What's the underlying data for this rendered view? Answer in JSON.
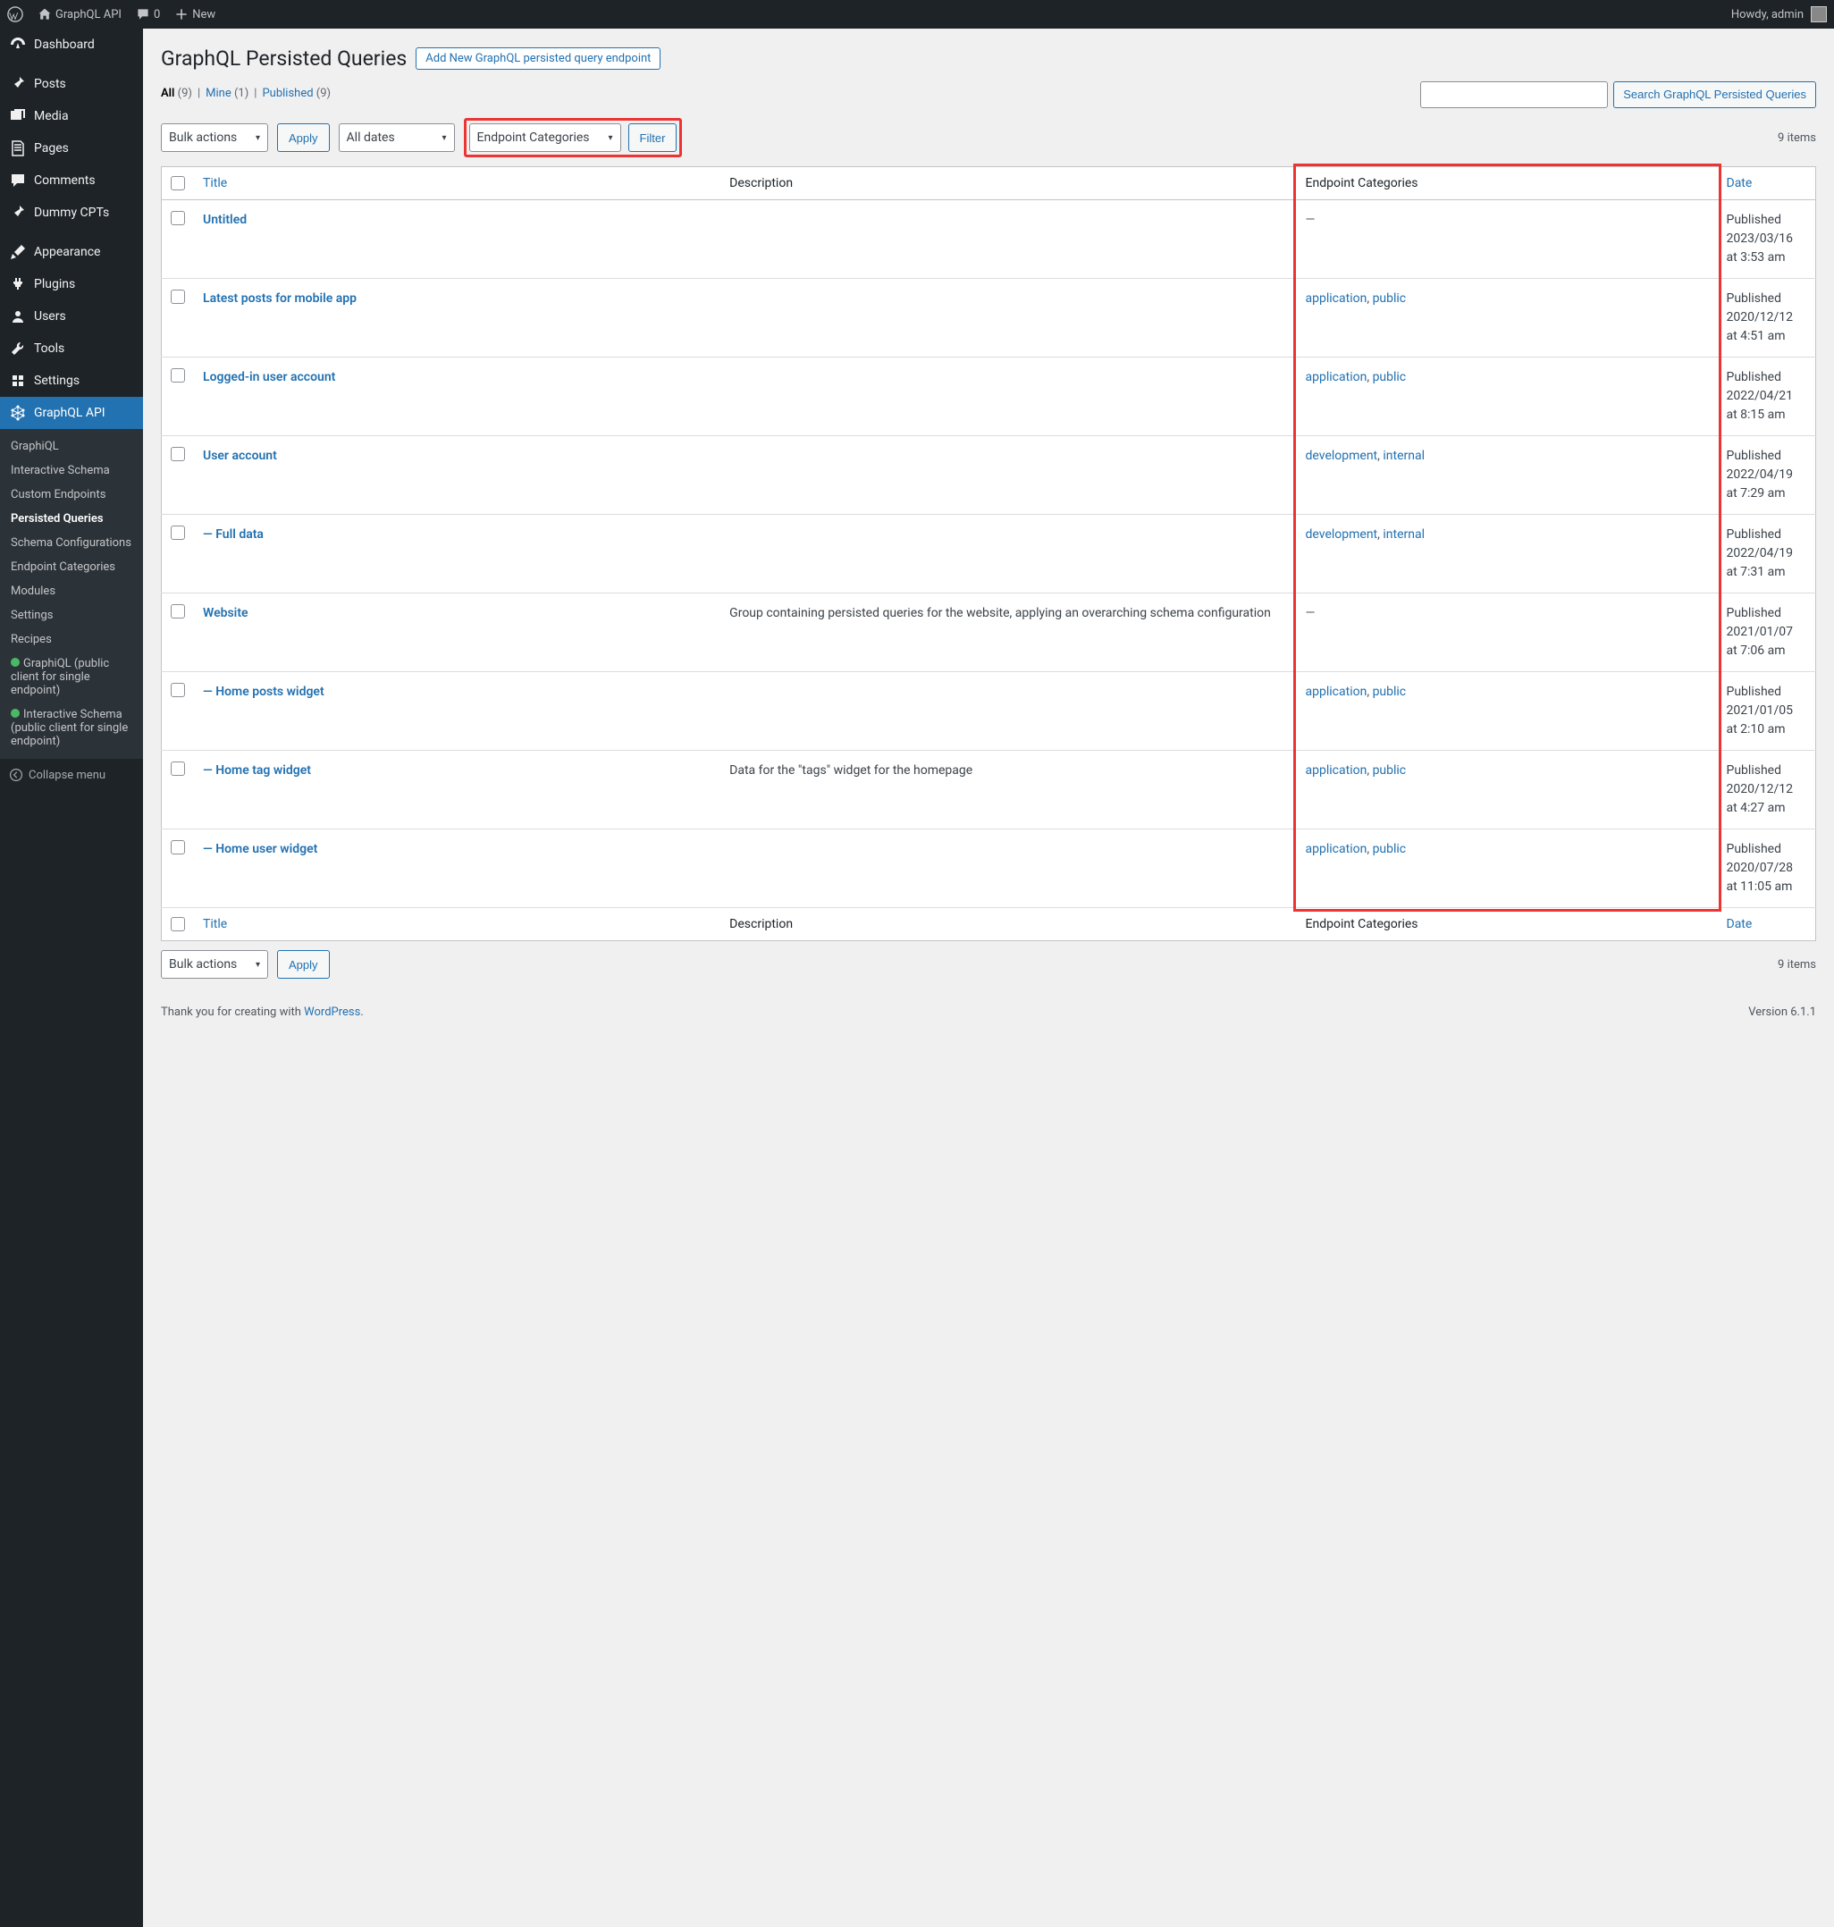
{
  "admin_bar": {
    "site_name": "GraphQL API",
    "comments": "0",
    "new": "New",
    "howdy": "Howdy, admin"
  },
  "sidebar": {
    "items": [
      {
        "label": "Dashboard",
        "icon": "dashboard"
      },
      {
        "label": "Posts",
        "icon": "pin"
      },
      {
        "label": "Media",
        "icon": "media"
      },
      {
        "label": "Pages",
        "icon": "pages"
      },
      {
        "label": "Comments",
        "icon": "comments"
      },
      {
        "label": "Dummy CPTs",
        "icon": "pin"
      },
      {
        "label": "Appearance",
        "icon": "brush"
      },
      {
        "label": "Plugins",
        "icon": "plugin"
      },
      {
        "label": "Users",
        "icon": "users"
      },
      {
        "label": "Tools",
        "icon": "tools"
      },
      {
        "label": "Settings",
        "icon": "settings"
      },
      {
        "label": "GraphQL API",
        "icon": "graphql"
      }
    ],
    "submenu": [
      {
        "label": "GraphiQL"
      },
      {
        "label": "Interactive Schema"
      },
      {
        "label": "Custom Endpoints"
      },
      {
        "label": "Persisted Queries",
        "current": true
      },
      {
        "label": "Schema Configurations"
      },
      {
        "label": "Endpoint Categories"
      },
      {
        "label": "Modules"
      },
      {
        "label": "Settings"
      },
      {
        "label": "Recipes"
      },
      {
        "label": "GraphiQL (public client for single endpoint)",
        "dot": true
      },
      {
        "label": "Interactive Schema (public client for single endpoint)",
        "dot": true
      }
    ],
    "collapse": "Collapse menu"
  },
  "page": {
    "title": "GraphQL Persisted Queries",
    "add_new": "Add New GraphQL persisted query endpoint"
  },
  "views": {
    "all_label": "All",
    "all_count": "(9)",
    "mine_label": "Mine",
    "mine_count": "(1)",
    "published_label": "Published",
    "published_count": "(9)"
  },
  "search": {
    "placeholder": "",
    "button": "Search GraphQL Persisted Queries"
  },
  "filters": {
    "bulk_actions": "Bulk actions",
    "apply": "Apply",
    "all_dates": "All dates",
    "endpoint_categories": "Endpoint Categories",
    "filter": "Filter",
    "items_count": "9 items"
  },
  "columns": {
    "title": "Title",
    "description": "Description",
    "categories": "Endpoint Categories",
    "date": "Date"
  },
  "rows": [
    {
      "title": "Untitled",
      "desc": "",
      "cats": [],
      "dash": "—",
      "date": "Published\n2023/03/16 at 3:53 am"
    },
    {
      "title": "Latest posts for mobile app",
      "desc": "",
      "cats": [
        "application",
        "public"
      ],
      "date": "Published\n2020/12/12 at 4:51 am"
    },
    {
      "title": "Logged-in user account",
      "desc": "",
      "cats": [
        "application",
        "public"
      ],
      "date": "Published\n2022/04/21 at 8:15 am"
    },
    {
      "title": "User account",
      "desc": "",
      "cats": [
        "development",
        "internal"
      ],
      "date": "Published\n2022/04/19 at 7:29 am"
    },
    {
      "title": "— Full data",
      "desc": "",
      "cats": [
        "development",
        "internal"
      ],
      "date": "Published\n2022/04/19 at 7:31 am",
      "indent": true
    },
    {
      "title": "Website",
      "desc": "Group containing persisted queries for the website, applying an overarching schema configuration",
      "cats": [],
      "dash": "—",
      "date": "Published\n2021/01/07 at 7:06 am"
    },
    {
      "title": "— Home posts widget",
      "desc": "",
      "cats": [
        "application",
        "public"
      ],
      "date": "Published\n2021/01/05 at 2:10 am",
      "indent": true
    },
    {
      "title": "— Home tag widget",
      "desc": "Data for the \"tags\" widget for the homepage",
      "cats": [
        "application",
        "public"
      ],
      "date": "Published\n2020/12/12 at 4:27 am",
      "indent": true
    },
    {
      "title": "— Home user widget",
      "desc": "",
      "cats": [
        "application",
        "public"
      ],
      "date": "Published\n2020/07/28 at 11:05 am",
      "indent": true
    }
  ],
  "footer": {
    "thanks": "Thank you for creating with ",
    "wp": "WordPress",
    "period": ".",
    "version": "Version 6.1.1"
  }
}
